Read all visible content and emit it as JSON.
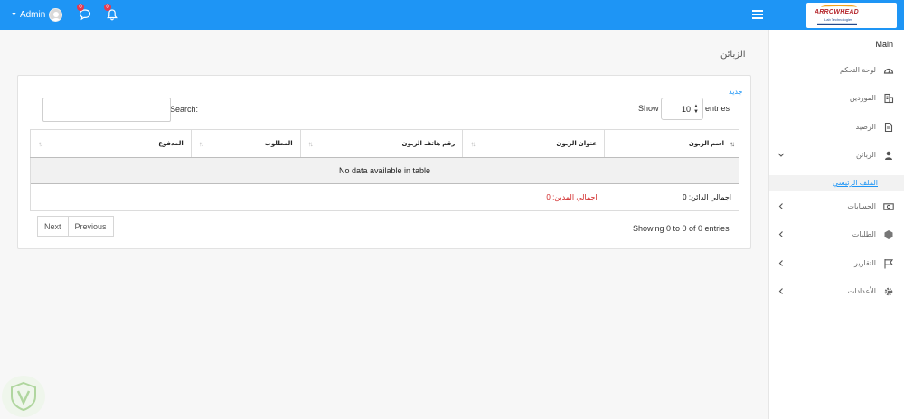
{
  "topbar": {
    "user_name": "Admin",
    "messages_count": "0",
    "notifications_count": "0",
    "background_color": "#1e95f5",
    "icons": [
      "caret-down-icon",
      "user-avatar-icon",
      "chat-bubble-icon",
      "bell-icon",
      "hamburger-menu-icon"
    ]
  },
  "brand": {
    "name": "ARROWHEAD",
    "tagline": "Lab Technologies"
  },
  "sidebar": {
    "main_label": "Main",
    "items": [
      {
        "label": "لوحة التحكم",
        "icon": "dashboard-icon"
      },
      {
        "label": "الموردين",
        "icon": "suppliers-icon"
      },
      {
        "label": "الرصيد",
        "icon": "document-icon"
      },
      {
        "label": "الزبائن",
        "icon": "user-icon",
        "expanded": true
      },
      {
        "label": "الحسابات",
        "icon": "money-icon"
      },
      {
        "label": "الطلبات",
        "icon": "box-icon"
      },
      {
        "label": "التقارير",
        "icon": "flag-icon"
      },
      {
        "label": "الأعدادات",
        "icon": "gear-icon"
      }
    ],
    "submenu": {
      "label": "الملف الرئيسي"
    }
  },
  "page": {
    "title": "الزبائن",
    "new_link": "جديد"
  },
  "table_controls": {
    "show_label": "Show",
    "entries_label": "entries",
    "page_length": "10",
    "search_label": "Search:",
    "search_value": ""
  },
  "table": {
    "columns": [
      "اسم الزبون",
      "عنوان الزبون",
      "رقم هاتف الزبون",
      "المطلوب",
      "المدفوع"
    ],
    "sorted_column": "اسم الزبون",
    "empty_message": "No data available in table",
    "footer": {
      "total_debtors": "اجمالي الدائن: 0",
      "total_creditors": "اجمالي المدين: 0"
    }
  },
  "pagination": {
    "info": "Showing 0 to 0 of 0 entries",
    "previous": "Previous",
    "next": "Next"
  },
  "colors": {
    "accent": "#1e95f5",
    "badge": "#e5384e",
    "debt_text": "#d02424"
  }
}
